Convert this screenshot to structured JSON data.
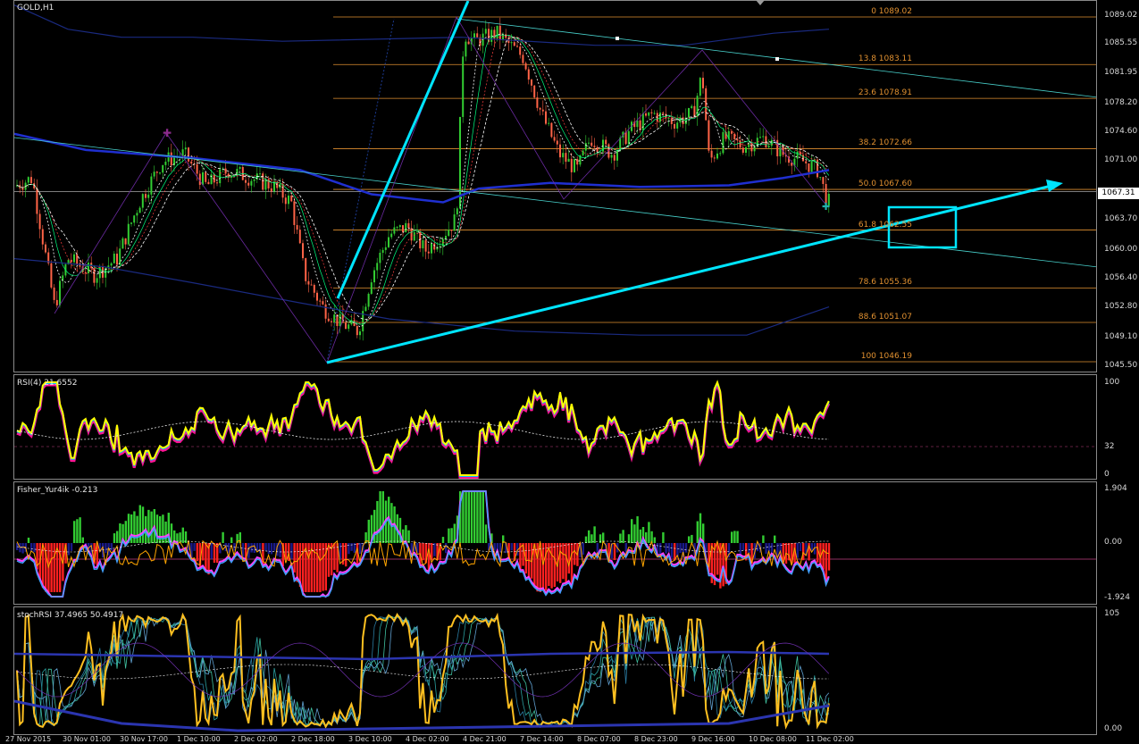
{
  "window": {
    "title": "GOLD,H1"
  },
  "price_scale": [
    "1089.02",
    "1085.55",
    "1081.95",
    "1078.20",
    "1074.60",
    "1071.00",
    "1067.31",
    "1063.70",
    "1060.00",
    "1056.40",
    "1052.80",
    "1049.10",
    "1045.50"
  ],
  "current_price": "1067.31",
  "fibonacci": [
    {
      "label": "0 1089.02",
      "value": 1089.02
    },
    {
      "label": "13.8 1083.11",
      "value": 1083.11
    },
    {
      "label": "23.6 1078.91",
      "value": 1078.91
    },
    {
      "label": "38.2 1072.66",
      "value": 1072.66
    },
    {
      "label": "50.0 1067.60",
      "value": 1067.6
    },
    {
      "label": "61.8 1062.55",
      "value": 1062.55
    },
    {
      "label": "78.6 1055.36",
      "value": 1055.36
    },
    {
      "label": "88.6 1051.07",
      "value": 1051.07
    },
    {
      "label": "100 1046.19",
      "value": 1046.19
    }
  ],
  "indicators": {
    "rsi": {
      "label": "RSI(4) 21.6552",
      "scale": [
        "100",
        "32",
        "0"
      ]
    },
    "fisher": {
      "label": "Fisher_Yur4ik -0.213",
      "scale": [
        "1.904",
        "0.00",
        "-1.924"
      ]
    },
    "stoch": {
      "label": "stochRSI 37.4965 50.4917",
      "scale": [
        "105",
        "0.00"
      ]
    }
  },
  "time_axis": [
    "27 Nov 2015",
    "30 Nov 01:00",
    "30 Nov 17:00",
    "1 Dec 10:00",
    "2 Dec 02:00",
    "2 Dec 18:00",
    "3 Dec 10:00",
    "4 Dec 02:00",
    "4 Dec 21:00",
    "7 Dec 14:00",
    "8 Dec 07:00",
    "8 Dec 23:00",
    "9 Dec 16:00",
    "10 Dec 08:00",
    "11 Dec 02:00"
  ],
  "colors": {
    "bull": "#32cd32",
    "bear": "#ff6347",
    "fib": "#e09030",
    "channel": "#48d1cc",
    "arrow": "#00e5ff",
    "ma": "#1f2fd0",
    "rsi": "#ffff00"
  }
}
